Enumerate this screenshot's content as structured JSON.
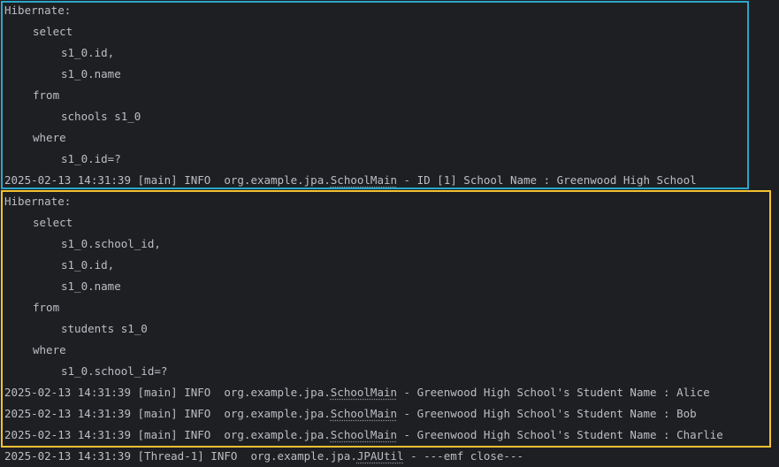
{
  "block1": {
    "hibernate": "Hibernate:",
    "select": "select",
    "col1": "s1_0.id,",
    "col2": "s1_0.name",
    "from": "from",
    "table": "schools s1_0",
    "where": "where",
    "cond": "s1_0.id=?",
    "log": {
      "prefix": "2025-02-13 14:31:39 [main] INFO  org.example.jpa.",
      "cls": "SchoolMain",
      "msg": " - ID [1] School Name : Greenwood High School"
    }
  },
  "block2": {
    "hibernate": "Hibernate:",
    "select": "select",
    "col1": "s1_0.school_id,",
    "col2": "s1_0.id,",
    "col3": "s1_0.name",
    "from": "from",
    "table": "students s1_0",
    "where": "where",
    "cond": "s1_0.school_id=?",
    "logs": [
      {
        "prefix": "2025-02-13 14:31:39 [main] INFO  org.example.jpa.",
        "cls": "SchoolMain",
        "msg": " - Greenwood High School's Student Name : Alice"
      },
      {
        "prefix": "2025-02-13 14:31:39 [main] INFO  org.example.jpa.",
        "cls": "SchoolMain",
        "msg": " - Greenwood High School's Student Name : Bob"
      },
      {
        "prefix": "2025-02-13 14:31:39 [main] INFO  org.example.jpa.",
        "cls": "SchoolMain",
        "msg": " - Greenwood High School's Student Name : Charlie"
      }
    ]
  },
  "final": {
    "prefix": "2025-02-13 14:31:39 [Thread-1] INFO  org.example.jpa.",
    "cls": "JPAUtil",
    "msg": " - ---emf close---"
  },
  "colors": {
    "background": "#1e1f22",
    "text": "#bcbec4",
    "highlight_blue": "#2aa6c9",
    "highlight_yellow": "#f2c232"
  }
}
